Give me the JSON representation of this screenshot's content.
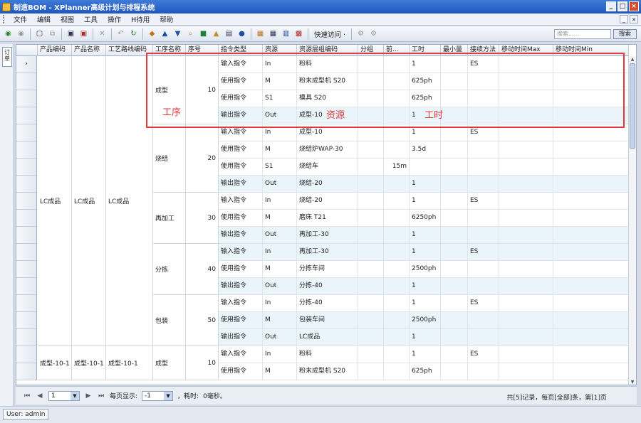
{
  "window": {
    "title": "制造BOM - XPlanner高级计划与排程系统",
    "buttons": [
      "_",
      "□",
      "×"
    ]
  },
  "menu": {
    "items": [
      "文件",
      "编辑",
      "视图",
      "工具",
      "操作",
      "H待用",
      "帮助"
    ],
    "mdi_buttons": [
      "_",
      "×"
    ]
  },
  "toolbar": {
    "quick_action_label": "快速访问 ·",
    "search_placeholder": "搜索......",
    "search_button": "搜索"
  },
  "side_tab": {
    "label": "订单"
  },
  "grid": {
    "columns": [
      "产品编码",
      "产品名称",
      "工艺路线编码",
      "工序名称",
      "序号",
      "指令类型",
      "资源",
      "资源层组编码",
      "分组",
      "前...",
      "工时",
      "最小量",
      "接续方法",
      "移动时间Max",
      "移动时间Min"
    ],
    "row_marker": "›",
    "groups": [
      {
        "product_code": "LC成品",
        "product_name": "LC成品",
        "route": "LC成品"
      },
      {
        "product_code": "成型-10-1",
        "product_name": "成型-10-1",
        "route": "成型-10-1"
      }
    ],
    "operations": [
      {
        "name": "成型",
        "seq": "10"
      },
      {
        "name": "烧结",
        "seq": "20"
      },
      {
        "name": "再加工",
        "seq": "30"
      },
      {
        "name": "分拣",
        "seq": "40"
      },
      {
        "name": "包装",
        "seq": "50"
      },
      {
        "name": "成型",
        "seq": "10"
      }
    ],
    "rows": [
      {
        "type": "输入指令",
        "res": "In",
        "code": "粉料",
        "group": "",
        "front": "",
        "time": "1",
        "min": "",
        "method": "ES"
      },
      {
        "type": "使用指令",
        "res": "M",
        "code": "粉末成型机 S20",
        "group": "",
        "front": "",
        "time": "625ph",
        "min": "",
        "method": ""
      },
      {
        "type": "使用指令",
        "res": "S1",
        "code": "模具 S20",
        "group": "",
        "front": "",
        "time": "625ph",
        "min": "",
        "method": ""
      },
      {
        "type": "输出指令",
        "res": "Out",
        "code": "成型-10",
        "group": "",
        "front": "",
        "time": "1",
        "min": "",
        "method": ""
      },
      {
        "type": "输入指令",
        "res": "In",
        "code": "成型-10",
        "group": "",
        "front": "",
        "time": "1",
        "min": "",
        "method": "ES"
      },
      {
        "type": "使用指令",
        "res": "M",
        "code": "烧结炉WAP-30",
        "group": "",
        "front": "",
        "time": "3.5d",
        "min": "",
        "method": ""
      },
      {
        "type": "使用指令",
        "res": "S1",
        "code": "烧结车",
        "group": "",
        "front": "15m",
        "time": "",
        "min": "",
        "method": ""
      },
      {
        "type": "输出指令",
        "res": "Out",
        "code": "烧结-20",
        "group": "",
        "front": "",
        "time": "1",
        "min": "",
        "method": ""
      },
      {
        "type": "输入指令",
        "res": "In",
        "code": "烧结-20",
        "group": "",
        "front": "",
        "time": "1",
        "min": "",
        "method": "ES"
      },
      {
        "type": "使用指令",
        "res": "M",
        "code": "磨床 T21",
        "group": "",
        "front": "",
        "time": "6250ph",
        "min": "",
        "method": ""
      },
      {
        "type": "输出指令",
        "res": "Out",
        "code": "再加工-30",
        "group": "",
        "front": "",
        "time": "1",
        "min": "",
        "method": ""
      },
      {
        "type": "输入指令",
        "res": "In",
        "code": "再加工-30",
        "group": "",
        "front": "",
        "time": "1",
        "min": "",
        "method": "ES"
      },
      {
        "type": "使用指令",
        "res": "M",
        "code": "分拣车间",
        "group": "",
        "front": "",
        "time": "2500ph",
        "min": "",
        "method": ""
      },
      {
        "type": "输出指令",
        "res": "Out",
        "code": "分拣-40",
        "group": "",
        "front": "",
        "time": "1",
        "min": "",
        "method": ""
      },
      {
        "type": "输入指令",
        "res": "In",
        "code": "分拣-40",
        "group": "",
        "front": "",
        "time": "1",
        "min": "",
        "method": "ES"
      },
      {
        "type": "使用指令",
        "res": "M",
        "code": "包装车间",
        "group": "",
        "front": "",
        "time": "2500ph",
        "min": "",
        "method": ""
      },
      {
        "type": "输出指令",
        "res": "Out",
        "code": "LC成品",
        "group": "",
        "front": "",
        "time": "1",
        "min": "",
        "method": ""
      },
      {
        "type": "输入指令",
        "res": "In",
        "code": "粉料",
        "group": "",
        "front": "",
        "time": "1",
        "min": "",
        "method": "ES"
      },
      {
        "type": "使用指令",
        "res": "M",
        "code": "粉末成型机 S20",
        "group": "",
        "front": "",
        "time": "625ph",
        "min": "",
        "method": ""
      }
    ]
  },
  "annotations": {
    "process": "工序",
    "resource": "资源",
    "work_time": "工时"
  },
  "pager": {
    "page": "1",
    "page_size_label": "每页显示:",
    "page_size": "-1",
    "elapsed_label": "，耗时:",
    "elapsed": "0毫秒。",
    "summary": "共[5]记录，每页[全部]条，第[1]页"
  },
  "status": {
    "user": "User: admin"
  },
  "colors": {
    "accent": "#1e57bf",
    "annotation": "#e23a3a",
    "row_alt": "#eaf4fb"
  }
}
